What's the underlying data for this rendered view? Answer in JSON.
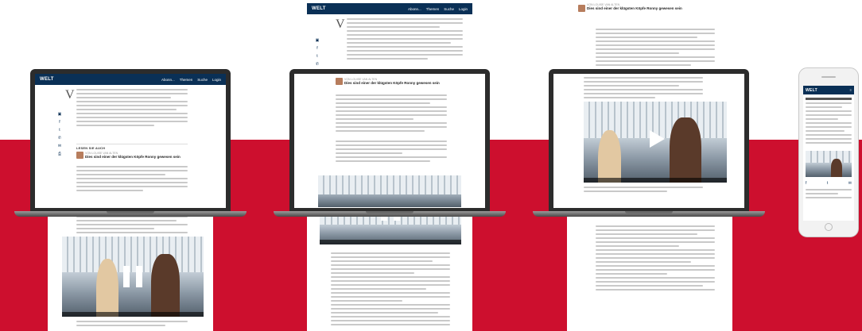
{
  "brand": {
    "logo": "WELT",
    "nav_color": "#0a3056",
    "accent": "#cd0f2e"
  },
  "nav": {
    "abonnieren": "Abonn...",
    "themen": "Themen",
    "suche": "Suche",
    "login": "Login"
  },
  "teaser": {
    "label": "LESEN SIE AUCH",
    "author": "VON LOUISE VAN ALTEN",
    "title": "Dies sind einer der klügsten Köpfe Ronny gewesen sein"
  },
  "article": {
    "drop_cap": "V"
  },
  "share_icons": [
    "facebook-icon",
    "twitter-icon",
    "whatsapp-icon",
    "mail-icon",
    "print-icon"
  ],
  "share_glyphs": [
    "▣",
    "f",
    "t",
    "✆",
    "✉",
    "⎙"
  ],
  "video": {
    "state_desktop": "paused",
    "state_tablet": "paused",
    "state_laptop3": "play"
  }
}
